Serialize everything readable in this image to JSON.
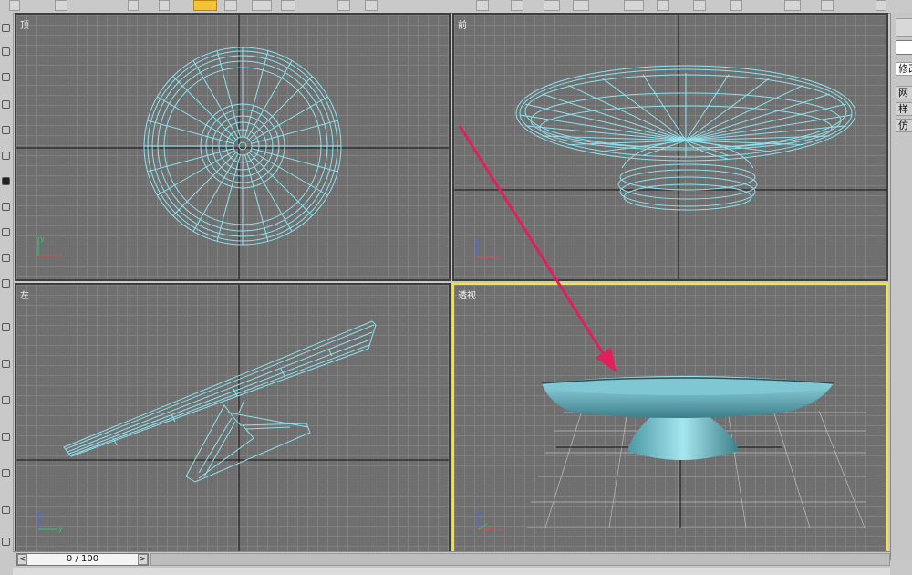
{
  "viewports": {
    "top": {
      "label": "顶"
    },
    "front": {
      "label": "前"
    },
    "left": {
      "label": "左"
    },
    "perspective": {
      "label": "透视"
    }
  },
  "axes": {
    "x": "x",
    "y": "y",
    "z": "z"
  },
  "timeline": {
    "frame_display": "0 / 100",
    "prev_arrow": "<",
    "next_arrow": ">"
  },
  "command_panel": {
    "tab_modify": "修改",
    "items": [
      "网",
      "样",
      "仿"
    ]
  },
  "colors": {
    "viewport_bg": "#6f6f6f",
    "grid_line": "#808080",
    "wireframe": "#8fe1ee",
    "active_border": "#f2e43a",
    "annotation_arrow": "#e0205a",
    "shaded_object": "#7fd1dc"
  },
  "icons": {
    "select": "cursor-arrow-icon",
    "axis_gizmo": "axis-tripod-icon"
  }
}
